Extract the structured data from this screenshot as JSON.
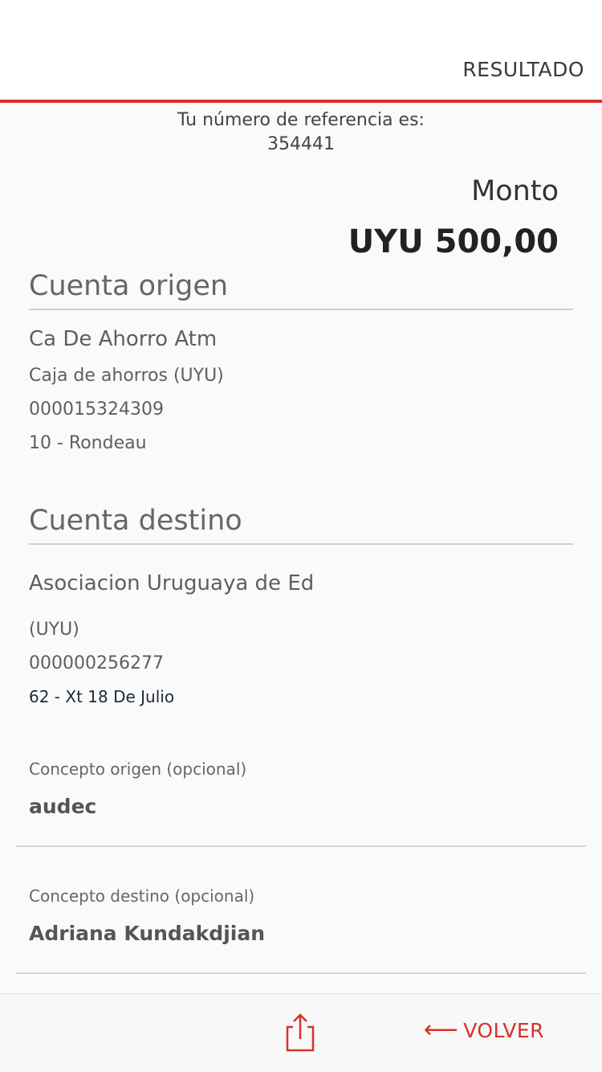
{
  "header": {
    "title": "RESULTADO"
  },
  "reference": {
    "label": "Tu número de referencia es:",
    "number": "354441"
  },
  "amount": {
    "label": "Monto",
    "value": "UYU 500,00"
  },
  "origin": {
    "title": "Cuenta origen",
    "name": "Ca De Ahorro Atm",
    "type": "Caja de ahorros (UYU)",
    "account_number": "000015324309",
    "branch": "10 - Rondeau"
  },
  "destination": {
    "title": "Cuenta destino",
    "name": "Asociacion Uruguaya de Ed",
    "type": "(UYU)",
    "account_number": "000000256277",
    "branch": "62 - Xt 18 De Julio"
  },
  "concept_origin": {
    "label": "Concepto origen (opcional)",
    "value": "audec"
  },
  "concept_destination": {
    "label": "Concepto destino (opcional)",
    "value": "Adriana Kundakdjian"
  },
  "footer": {
    "volver_label": "VOLVER",
    "volver_arrow": "⟵"
  },
  "colors": {
    "accent": "#d8312c",
    "background": "#fafafa"
  }
}
